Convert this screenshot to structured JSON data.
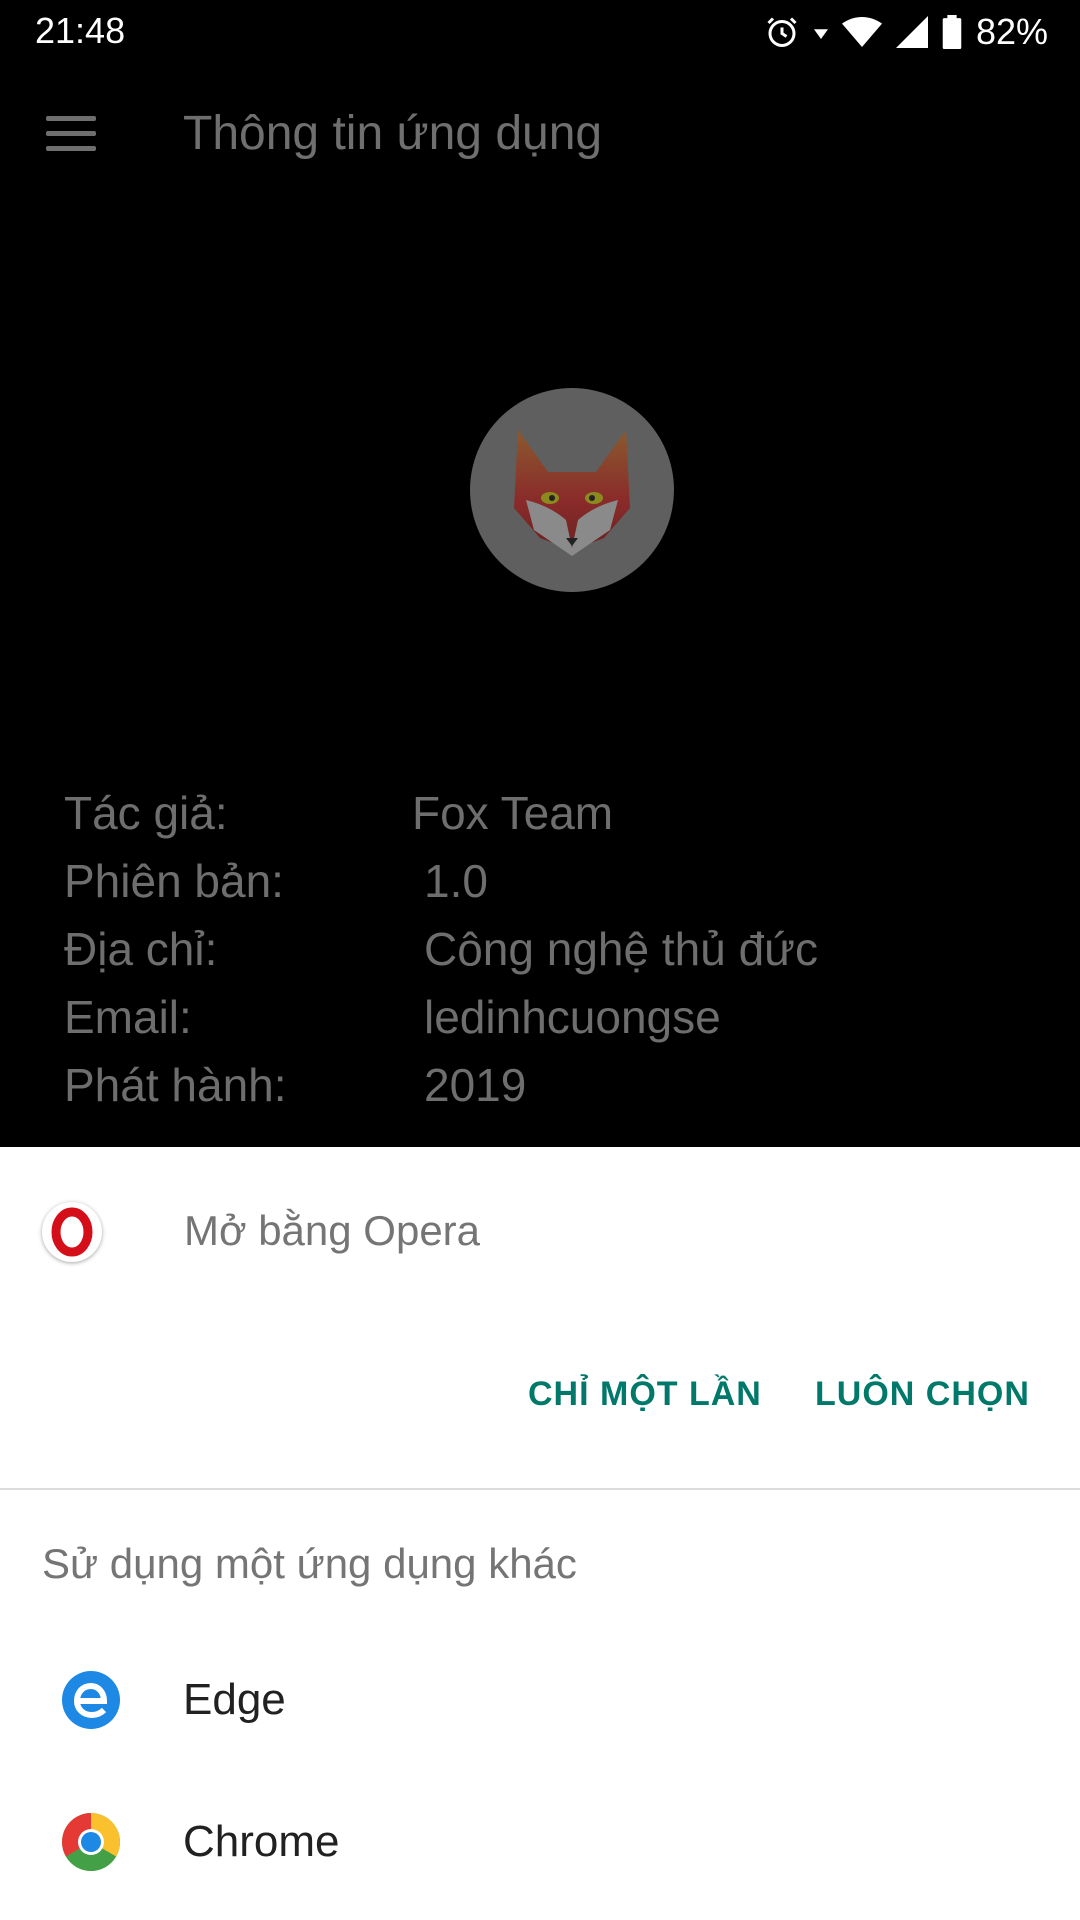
{
  "status_bar": {
    "time": "21:48",
    "battery": "82%"
  },
  "app_bar": {
    "title": "Thông tin ứng dụng"
  },
  "info": [
    {
      "label": "Tác giả:",
      "value": "Fox Team"
    },
    {
      "label": "Phiên bản:",
      "value": "1.0"
    },
    {
      "label": "Địa chỉ:",
      "value": "Công nghệ thủ đức"
    },
    {
      "label": "Email:",
      "value": "ledinhcuongse"
    },
    {
      "label": "Phát hành:",
      "value": "2019"
    }
  ],
  "sheet": {
    "open_with": "Mở bằng Opera",
    "just_once": "CHỈ MỘT LẦN",
    "always": "LUÔN CHỌN",
    "other_apps_title": "Sử dụng một ứng dụng khác",
    "apps": [
      {
        "label": "Edge",
        "icon": "edge-icon"
      },
      {
        "label": "Chrome",
        "icon": "chrome-icon"
      }
    ]
  },
  "colors": {
    "accent": "#00796b",
    "scrim": "#000000"
  }
}
